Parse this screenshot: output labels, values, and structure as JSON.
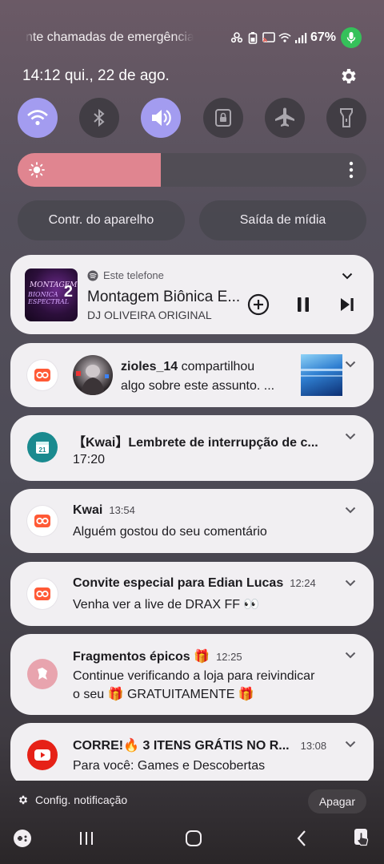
{
  "status_bar": {
    "ticker": "nte chamadas de emergência",
    "battery": "67%",
    "icons": [
      "sync-icon",
      "battery-saver-icon",
      "cast-icon",
      "wifi-icon",
      "signal-icon"
    ]
  },
  "header": {
    "datetime": "14:12  qui., 22 de ago.",
    "settings_icon": "gear-icon"
  },
  "quick_settings": {
    "toggles": [
      {
        "name": "wifi",
        "state": "on"
      },
      {
        "name": "bluetooth",
        "state": "off"
      },
      {
        "name": "sound",
        "state": "on"
      },
      {
        "name": "rotation-lock",
        "state": "off"
      },
      {
        "name": "airplane-mode",
        "state": "off"
      },
      {
        "name": "flashlight",
        "state": "off"
      }
    ],
    "brightness_level": 0.41,
    "device_control_label": "Contr. do aparelho",
    "media_output_label": "Saída de mídia"
  },
  "media": {
    "source": "Este telefone",
    "title": "Montagem Biônica E...",
    "artist": "DJ OLIVEIRA ORIGINAL",
    "album_art_text": [
      "MONTAGEM",
      "BIONICA ESPECTRAL",
      "2"
    ]
  },
  "notifications": [
    {
      "title": "zioles_14",
      "title_suffix": " compartilhou",
      "body": "algo sobre este assunto. ...",
      "time": ""
    },
    {
      "title": "【Kwai】Lembrete de interrupção de c...",
      "body": "17:20",
      "time": ""
    },
    {
      "title": "Kwai",
      "time": "13:54",
      "body": "Alguém gostou do seu comentário"
    },
    {
      "title": "Convite especial para Edian Lucas",
      "time": "12:24",
      "body": "Venha ver a live de DRAX FF 👀"
    },
    {
      "title": "Fragmentos épicos 🎁",
      "time": "12:25",
      "body": "Continue verificando a loja para reivindicar",
      "body2": "o seu 🎁 GRATUITAMENTE 🎁"
    },
    {
      "title": "CORRE!🔥 3 ITENS GRÁTIS NO R...",
      "time": "13:08",
      "body": "Para você: Games e Descobertas"
    }
  ],
  "footer": {
    "settings_label": "Config. notificação",
    "clear_label": "Apagar"
  },
  "colors": {
    "toggle_on": "#a39cf0",
    "brightness_fill": "#e08590",
    "kwai": "#ff5a36",
    "youtube": "#e62117",
    "calendar": "#1a8a8f"
  }
}
